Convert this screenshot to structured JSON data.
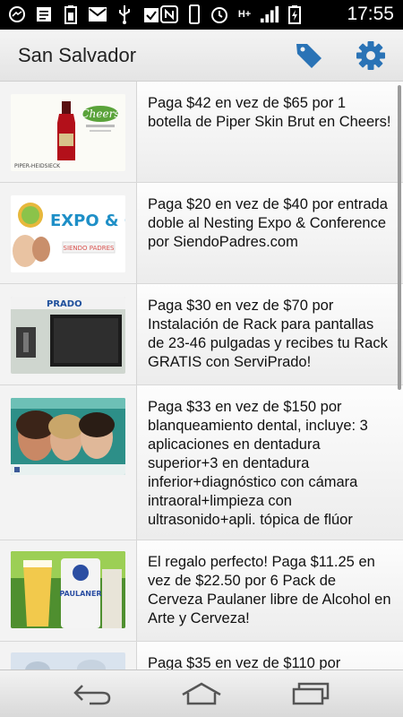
{
  "status_bar": {
    "time": "17:55",
    "network_label": "H+",
    "icons": [
      "messenger-icon",
      "notes-icon",
      "battery-saver-icon",
      "gmail-icon",
      "usb-icon",
      "clipboard-check-icon",
      "nfc-icon",
      "vibrate-icon",
      "alarm-icon",
      "signal-icon",
      "battery-charging-icon"
    ]
  },
  "action_bar": {
    "title": "San Salvador",
    "accent_color": "#2a73b6"
  },
  "deals": [
    {
      "text": "Paga $42 en vez de $65 por 1 botella de Piper Skin Brut en Cheers!",
      "thumb_caption": "Cheers",
      "thumb_brand": "PIPER-HEIDSIECK"
    },
    {
      "text": "Paga $20 en vez de $40 por entrada doble al Nesting Expo & Conference por SiendoPadres.com",
      "thumb_caption": "EXPO & CONFERENCES",
      "thumb_brand": "SIENDO PADRES"
    },
    {
      "text": "Paga $30 en vez de $70 por Instalación de Rack para pantallas de 23-46 pulgadas y recibes tu Rack GRATIS con ServiPrado!",
      "thumb_caption": "PRADO"
    },
    {
      "text": "Paga $33 en vez de $150 por blanqueamiento dental, incluye: 3 aplicaciones en dentadura superior+3 en dentadura inferior+diagnóstico con cámara intraoral+limpieza con ultrasonido+apli. tópica de flúor",
      "thumb_caption": ""
    },
    {
      "text": "El regalo perfecto! Paga $11.25 en vez de $22.50 por 6 Pack de Cerveza Paulaner libre de Alcohol en Arte y Cerveza!",
      "thumb_caption": "PAULANER"
    },
    {
      "text": "Paga $35 en vez de $110 por",
      "thumb_caption": ""
    }
  ]
}
